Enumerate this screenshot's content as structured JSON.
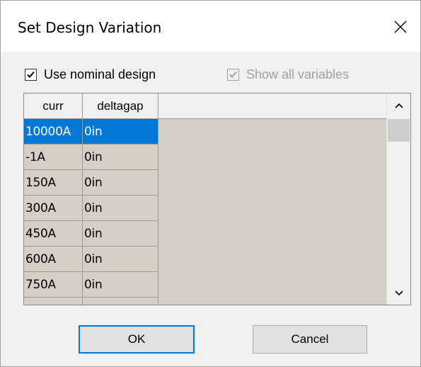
{
  "dialog": {
    "title": "Set Design Variation",
    "close_icon": "close-icon"
  },
  "options": {
    "use_nominal": {
      "label": "Use nominal design",
      "checked": true,
      "enabled": true
    },
    "show_all": {
      "label": "Show all variables",
      "checked": true,
      "enabled": false
    }
  },
  "grid": {
    "columns": [
      "curr",
      "deltagap"
    ],
    "rows": [
      [
        "10000A",
        "0in"
      ],
      [
        "-1A",
        "0in"
      ],
      [
        "150A",
        "0in"
      ],
      [
        "300A",
        "0in"
      ],
      [
        "450A",
        "0in"
      ],
      [
        "600A",
        "0in"
      ],
      [
        "750A",
        "0in"
      ]
    ],
    "selected_row": 0,
    "scroll_up_icon": "chevron-up-icon",
    "scroll_down_icon": "chevron-down-icon"
  },
  "buttons": {
    "ok": "OK",
    "cancel": "Cancel"
  },
  "colors": {
    "selection": "#0078d7",
    "grid_bg": "#d4d0c8"
  }
}
